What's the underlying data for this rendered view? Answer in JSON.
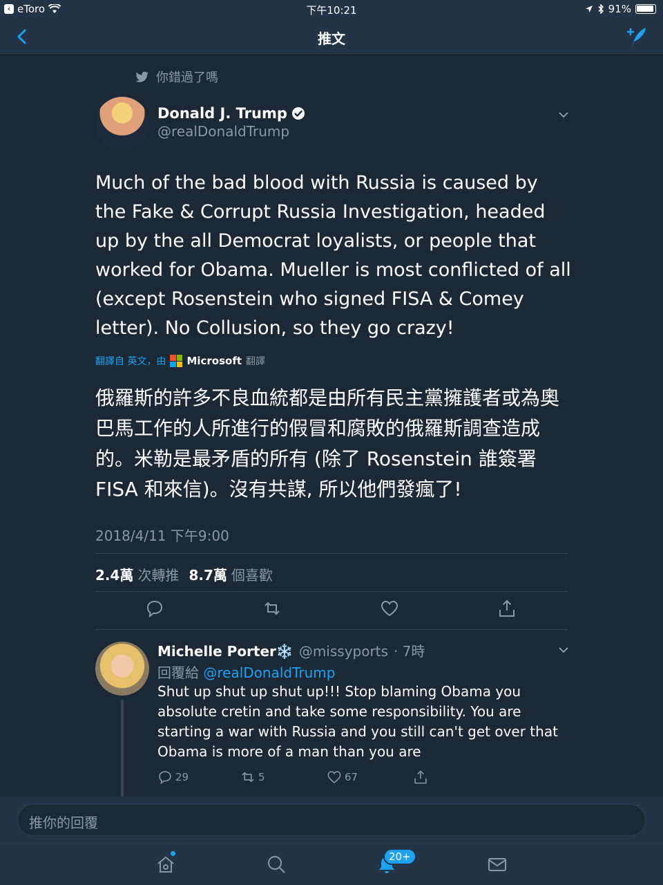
{
  "status_bar": {
    "back_app": "eToro",
    "time": "下午10:21",
    "battery": "91%"
  },
  "nav": {
    "title": "推文"
  },
  "context": {
    "label": "你錯過了嗎"
  },
  "tweet": {
    "author_name": "Donald J. Trump",
    "author_handle": "@realDonaldTrump",
    "text": "Much of the bad blood with Russia is caused by the Fake & Corrupt Russia Investigation, headed up by the all Democrat loyalists, or people that worked for Obama. Mueller is most conflicted of all (except Rosenstein who signed FISA & Comey letter). No Collusion, so they go crazy!",
    "translation_prefix": "翻譯自 英文，由",
    "translation_brand": "Microsoft",
    "translation_suffix": "翻譯",
    "translated_text": "俄羅斯的許多不良血統都是由所有民主黨擁護者或為奧巴馬工作的人所進行的假冒和腐敗的俄羅斯調查造成的。米勒是最矛盾的所有 (除了 Rosenstein 誰簽署 FISA 和來信)。沒有共謀, 所以他們發瘋了!",
    "timestamp": "2018/4/11 下午9:00",
    "retweets_count": "2.4萬",
    "retweets_label": "次轉推",
    "likes_count": "8.7萬",
    "likes_label": "個喜歡"
  },
  "reply": {
    "author_name": "Michelle  Porter❄️",
    "author_handle": "@missyports",
    "time": "· 7時",
    "reply_to_label": "回覆給",
    "reply_to_mention": "@realDonaldTrump",
    "text": "Shut up shut up shut up!!! Stop blaming Obama you absolute cretin and take some responsibility. You are starting a war with Russia and you still can't get over that Obama is more of a man than you are",
    "replies": "29",
    "retweets": "5",
    "likes": "67"
  },
  "composer": {
    "placeholder": "推你的回覆"
  },
  "tabbar": {
    "notifications_badge": "20+"
  },
  "colors": {
    "background": "#1b2836",
    "bar": "#243447",
    "accent": "#1da1f2",
    "muted": "#8899a6"
  }
}
